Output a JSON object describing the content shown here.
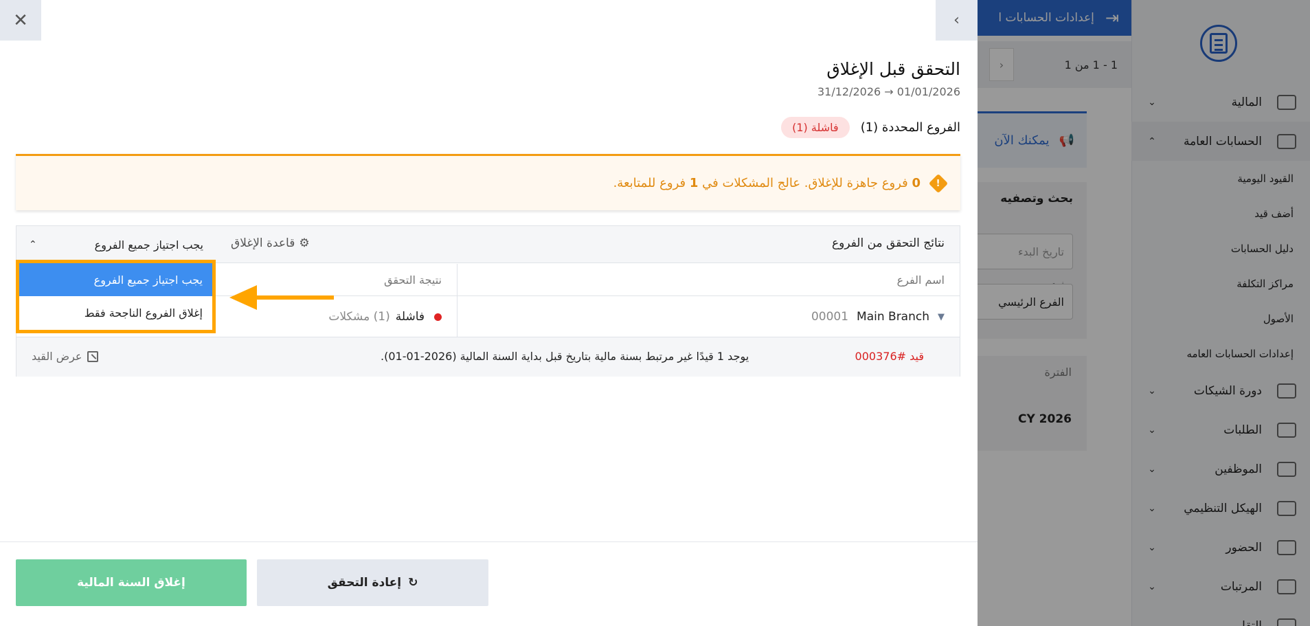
{
  "background": {
    "topbar_title": "إعدادات الحسابات ا",
    "pager_text": "1 - 1 من 1",
    "announcement": "يمكنك الآن",
    "filter_title": "بحث وتصفيه",
    "start_date_placeholder": "تاريخ البدء",
    "branch_label": "فرع",
    "branch_value": "الفرع الرئيسي",
    "period_label": "الفترة",
    "period_value": "CY 2026",
    "sidebar": {
      "items": [
        {
          "label": "المالية"
        },
        {
          "label": "الحسابات العامة"
        },
        {
          "label": "دورة الشيكات"
        },
        {
          "label": "الطلبات"
        },
        {
          "label": "الموظفين"
        },
        {
          "label": "الهيكل التنظيمي"
        },
        {
          "label": "الحضور"
        },
        {
          "label": "المرتبات"
        },
        {
          "label": "التقارير"
        }
      ],
      "sub_items": [
        {
          "label": "القيود اليومية"
        },
        {
          "label": "أضف قيد"
        },
        {
          "label": "دليل الحسابات"
        },
        {
          "label": "مراكز التكلفة"
        },
        {
          "label": "الأصول"
        },
        {
          "label": "إعدادات الحسابات العامه"
        }
      ]
    }
  },
  "drawer": {
    "title": "التحقق قبل الإغلاق",
    "dates": "31/12/2026 → 01/01/2026",
    "selected_branches": "الفروع المحددة (1)",
    "failed_badge": "فاشلة (1)",
    "alert": {
      "ready_count": "0",
      "text_part1": "فروع جاهزة للإغلاق. عالج المشكلات في",
      "followup_count": "1",
      "text_part2": "فروع للمتابعة."
    },
    "results": {
      "title": "نتائج التحقق من الفروع",
      "rule_label": "قاعدة الإغلاق",
      "rule_value": "يجب اجتياز جميع الفروع",
      "col_branch": "اسم الفرع",
      "col_result": "نتيجة التحقق",
      "row": {
        "branch_name": "Main Branch",
        "branch_code": "00001",
        "status": "فاشلة",
        "issues": "(1) مشكلات"
      },
      "issue": {
        "ref": "قيد #000376",
        "text": "يوجد 1 قيدًا غير مرتبط بسنة مالية بتاريخ قبل بداية السنة المالية (2026-01-01).",
        "view_label": "عرض القيد"
      }
    },
    "dropdown_options": [
      {
        "label": "يجب اجتياز جميع الفروع"
      },
      {
        "label": "إغلاق الفروع الناجحة فقط"
      }
    ],
    "buttons": {
      "close_year": "إغلاق السنة المالية",
      "recheck": "إعادة التحقق"
    }
  },
  "colors": {
    "primary": "#2e6bd1",
    "success": "#6fcf9e",
    "warning": "#f39c12",
    "danger": "#e02424",
    "highlight": "#ffa500"
  }
}
